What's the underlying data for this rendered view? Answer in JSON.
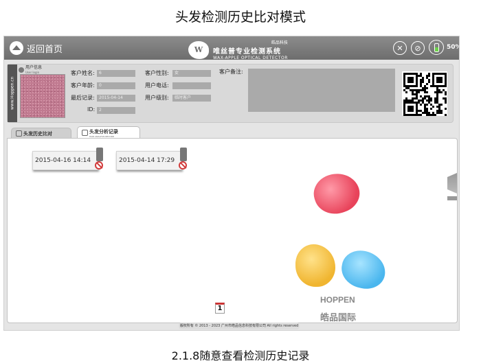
{
  "slide": {
    "title": "头发检测历史比对模式",
    "caption": "2.1.8随意查看检测历史记录"
  },
  "topbar": {
    "home_label": "返回首页",
    "brand_top": "皓品科技",
    "brand_main": "唯丝普专业检测系统",
    "brand_sub": "WAX-APPLE OPTICAL DETECTOR",
    "brand_logo_text": "W",
    "tools": [
      "settings-icon",
      "no-wifi-icon"
    ],
    "battery_percent": "50%",
    "battery_level": 0.5
  },
  "user_info": {
    "section_title": "用户信息",
    "section_sub": "User login",
    "side_strip": "www.Hoppen.cn",
    "fields": {
      "name_label": "客户姓名:",
      "name_value": "6",
      "gender_label": "客户性别:",
      "gender_value": "女",
      "age_label": "客户年龄:",
      "age_value": "0",
      "phone_label": "用户电话:",
      "phone_value": "",
      "last_label": "最后记录:",
      "last_value": "2015-04-14",
      "level_label": "用户级别:",
      "level_value": "临时客户",
      "id_label": "ID:",
      "id_value": "2",
      "note_label": "客户备注:",
      "note_value": ""
    }
  },
  "tabs": [
    {
      "title": "头发历史比对",
      "sub": "",
      "active": false
    },
    {
      "title": "头发分析记录",
      "sub": "HAIR ANALYSIS RECORD",
      "active": true
    }
  ],
  "records": [
    {
      "datetime": "2015-04-16 14:14"
    },
    {
      "datetime": "2015-04-14 17:29"
    }
  ],
  "pagination": {
    "current": "1"
  },
  "logo": {
    "en": "HOPPEN",
    "cn": "皓品国际"
  },
  "footer": {
    "text": "版权所有 © 2013 - 2023 广州市皓品信息科技有限公司 All rights reserved"
  }
}
